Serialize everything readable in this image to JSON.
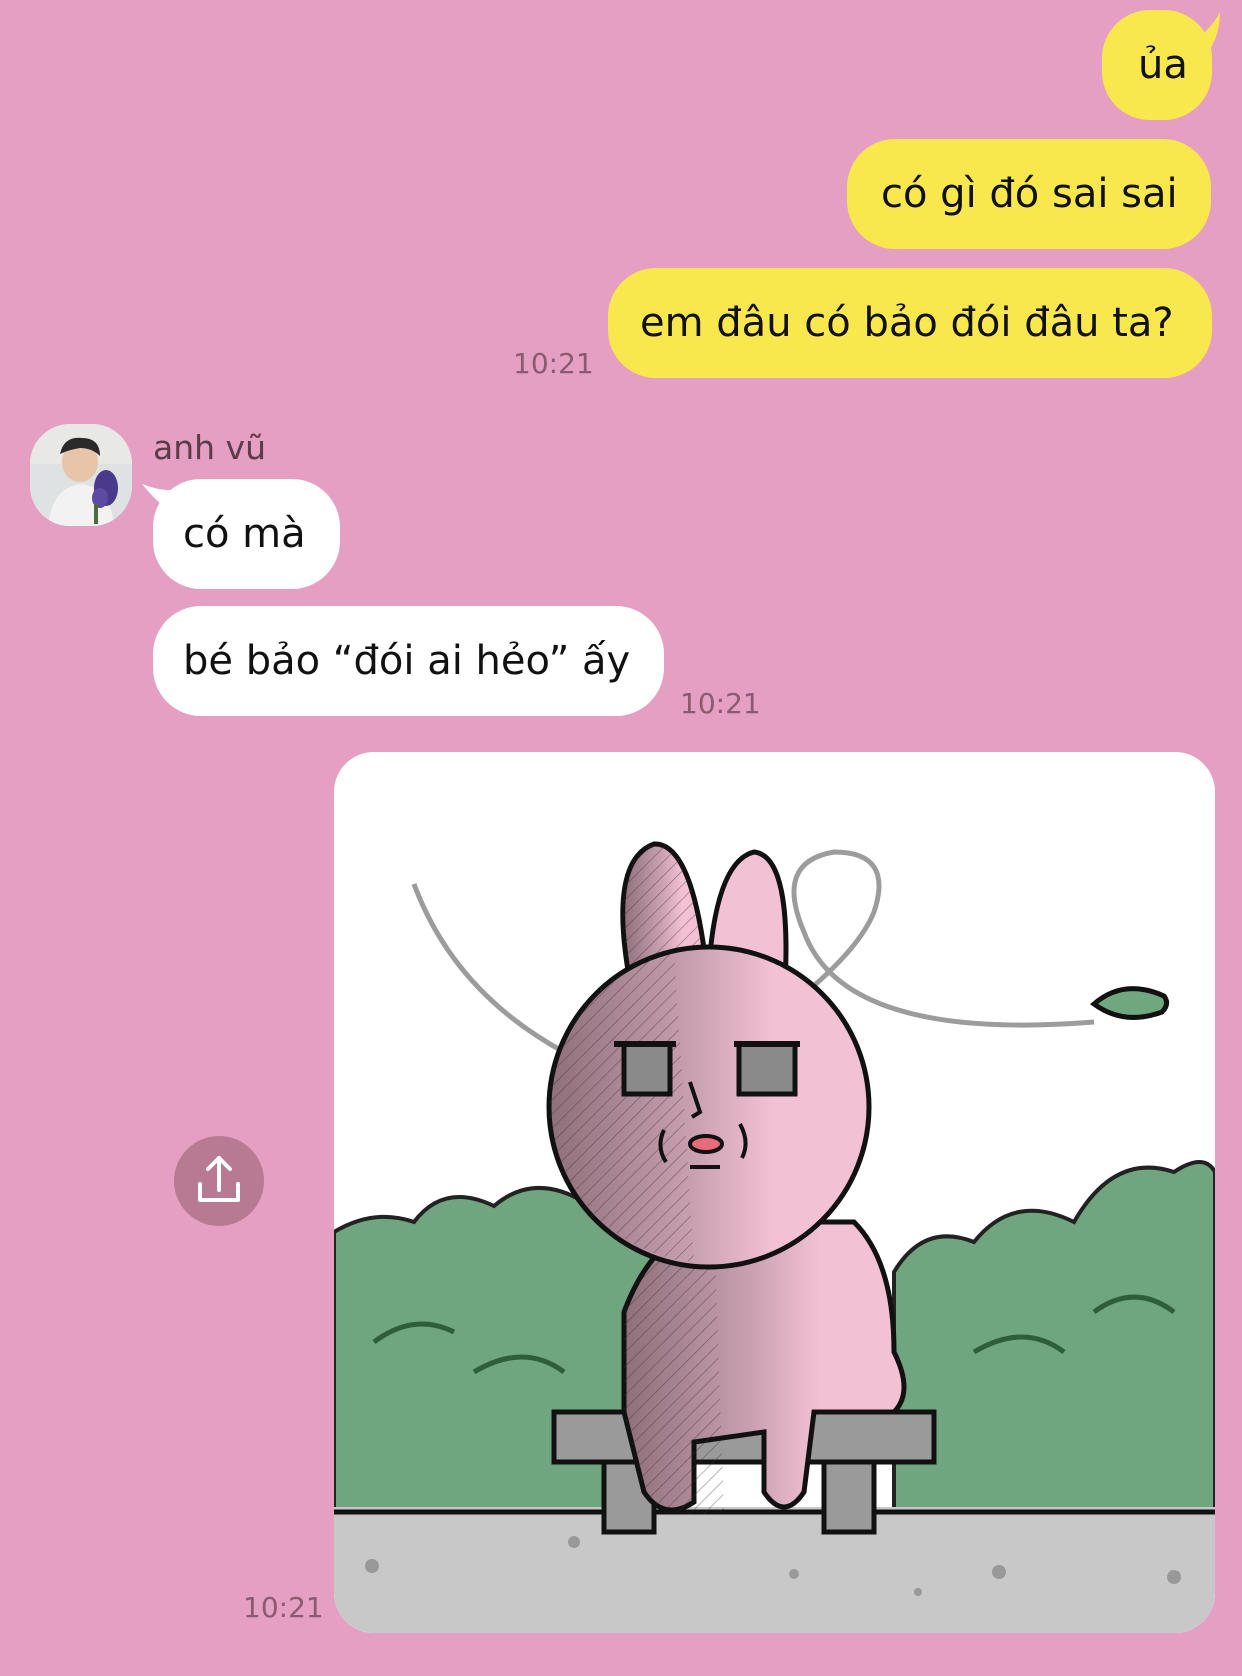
{
  "messages": {
    "out1": "ủa",
    "out2": "có gì đó sai sai",
    "out3": "em đâu có bảo đói đâu ta?",
    "out_time": "10:21",
    "sender_name": "anh vũ",
    "in1": "có mà",
    "in2": "bé bảo “đói ai hẻo” ấy",
    "in_time": "10:21",
    "sticker_time": "10:21"
  },
  "icons": {
    "share": "share-upload-icon",
    "sticker": "pink-rabbit-sticker"
  },
  "colors": {
    "background": "#e49fc2",
    "outgoing_bubble": "#f8e84e",
    "incoming_bubble": "#ffffff",
    "share_button": "#b87a93"
  }
}
